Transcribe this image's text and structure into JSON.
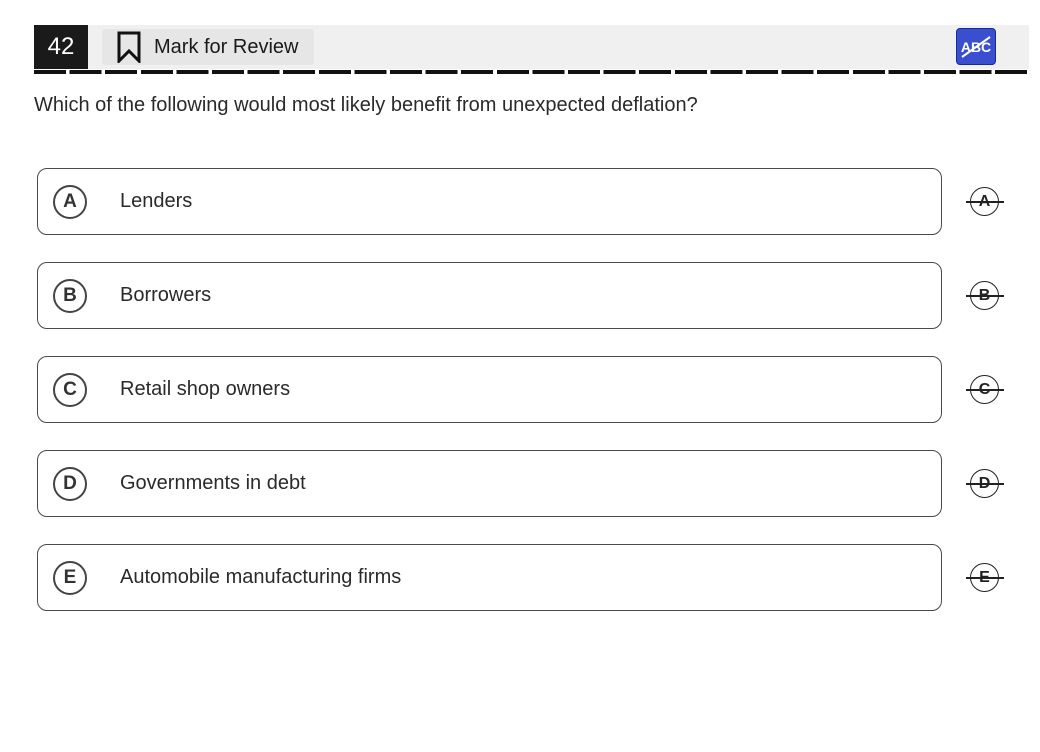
{
  "header": {
    "question_number": "42",
    "mark_for_review_label": "Mark for Review",
    "abc_button_text": "ABC",
    "accent_color": "#3a4fd0"
  },
  "question": {
    "text": "Which of the following would most likely benefit from unexpected deflation?"
  },
  "choices": [
    {
      "letter": "A",
      "text": "Lenders"
    },
    {
      "letter": "B",
      "text": "Borrowers"
    },
    {
      "letter": "C",
      "text": "Retail shop owners"
    },
    {
      "letter": "D",
      "text": "Governments in debt"
    },
    {
      "letter": "E",
      "text": "Automobile manufacturing firms"
    }
  ]
}
